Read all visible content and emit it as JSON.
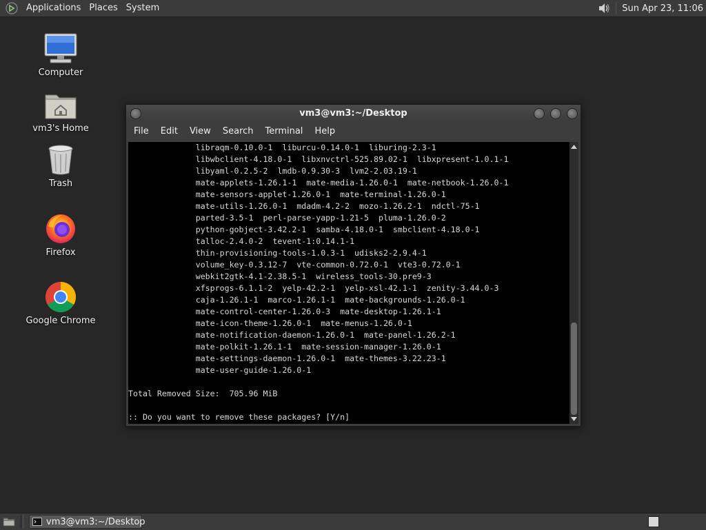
{
  "top_panel": {
    "menus": [
      "Applications",
      "Places",
      "System"
    ],
    "clock": "Sun Apr 23, 11:06",
    "icons": {
      "menu_logo": "mate-logo-icon",
      "volume": "speaker-icon"
    }
  },
  "desktop_icons": [
    {
      "label": "Computer",
      "icon": "computer-icon"
    },
    {
      "label": "vm3's Home",
      "icon": "home-folder-icon"
    },
    {
      "label": "Trash",
      "icon": "trash-icon"
    },
    {
      "label": "Firefox",
      "icon": "firefox-icon"
    },
    {
      "label": "Google Chrome",
      "icon": "chrome-icon"
    }
  ],
  "window": {
    "title": "vm3@vm3:~/Desktop",
    "menu": [
      "File",
      "Edit",
      "View",
      "Search",
      "Terminal",
      "Help"
    ],
    "terminal_lines": [
      "              libraqm-0.10.0-1  liburcu-0.14.0-1  liburing-2.3-1",
      "              libwbclient-4.18.0-1  libxnvctrl-525.89.02-1  libxpresent-1.0.1-1",
      "              libyaml-0.2.5-2  lmdb-0.9.30-3  lvm2-2.03.19-1",
      "              mate-applets-1.26.1-1  mate-media-1.26.0-1  mate-netbook-1.26.0-1",
      "              mate-sensors-applet-1.26.0-1  mate-terminal-1.26.0-1",
      "              mate-utils-1.26.0-1  mdadm-4.2-2  mozo-1.26.2-1  ndctl-75-1",
      "              parted-3.5-1  perl-parse-yapp-1.21-5  pluma-1.26.0-2",
      "              python-gobject-3.42.2-1  samba-4.18.0-1  smbclient-4.18.0-1",
      "              talloc-2.4.0-2  tevent-1:0.14.1-1",
      "              thin-provisioning-tools-1.0.3-1  udisks2-2.9.4-1",
      "              volume_key-0.3.12-7  vte-common-0.72.0-1  vte3-0.72.0-1",
      "              webkit2gtk-4.1-2.38.5-1  wireless_tools-30.pre9-3",
      "              xfsprogs-6.1.1-2  yelp-42.2-1  yelp-xsl-42.1-1  zenity-3.44.0-3",
      "              caja-1.26.1-1  marco-1.26.1-1  mate-backgrounds-1.26.0-1",
      "              mate-control-center-1.26.0-3  mate-desktop-1.26.1-1",
      "              mate-icon-theme-1.26.0-1  mate-menus-1.26.0-1",
      "              mate-notification-daemon-1.26.0-1  mate-panel-1.26.2-1",
      "              mate-polkit-1.26.1-1  mate-session-manager-1.26.0-1",
      "              mate-settings-daemon-1.26.0-1  mate-themes-3.22.23-1",
      "              mate-user-guide-1.26.0-1",
      "",
      "Total Removed Size:  705.96 MiB",
      "",
      ":: Do you want to remove these packages? [Y/n]"
    ]
  },
  "taskbar": {
    "items": [
      {
        "label": "vm3@vm3:~/Desktop",
        "icon": "terminal-icon"
      }
    ]
  }
}
